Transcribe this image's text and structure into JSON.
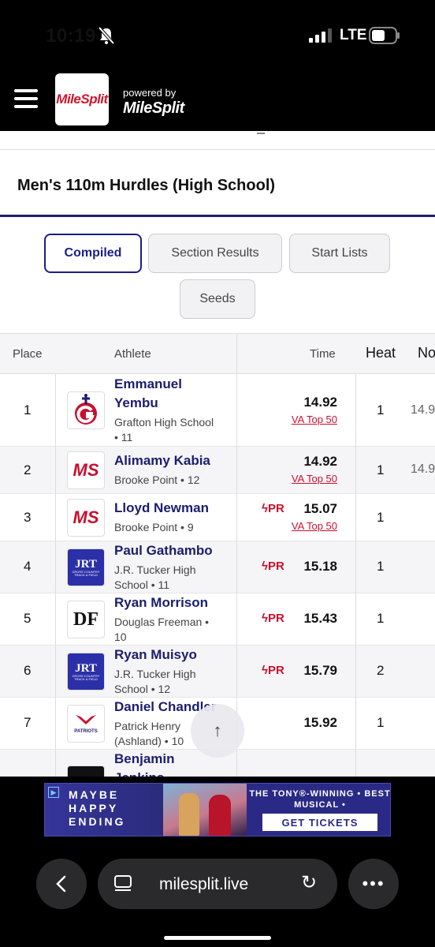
{
  "status_bar": {
    "time": "10:19",
    "network": "LTE"
  },
  "header": {
    "logo_text": "MileSplit",
    "powered_by": "powered by",
    "brand": "MileSplit"
  },
  "event": {
    "title": "Men's 110m Hurdles (High School)"
  },
  "tabs": [
    {
      "label": "Compiled",
      "active": true
    },
    {
      "label": "Section Results",
      "active": false
    },
    {
      "label": "Start Lists",
      "active": false
    },
    {
      "label": "Seeds",
      "active": false
    }
  ],
  "table": {
    "columns": {
      "place": "Place",
      "athlete": "Athlete",
      "time": "Time",
      "heat": "Heat",
      "note": "No"
    },
    "rows": [
      {
        "place": "1",
        "name_line1": "Emmanuel",
        "name_line2": "Yembu",
        "school_line1": "Grafton High School",
        "school_line2": "• 11",
        "time": "14.92",
        "badge": "VA Top 50",
        "pr": "",
        "heat": "1",
        "note": "14.9",
        "logo": "grafton-logo"
      },
      {
        "place": "2",
        "name_line1": "Alimamy Kabia",
        "name_line2": "",
        "school_line1": "Brooke Point • 12",
        "school_line2": "",
        "time": "14.92",
        "badge": "VA Top 50",
        "pr": "",
        "heat": "1",
        "note": "14.9",
        "logo": "ms-logo"
      },
      {
        "place": "3",
        "name_line1": "Lloyd Newman",
        "name_line2": "",
        "school_line1": "Brooke Point • 9",
        "school_line2": "",
        "time": "15.07",
        "badge": "VA Top 50",
        "pr": "PR",
        "heat": "1",
        "note": "",
        "logo": "ms-logo"
      },
      {
        "place": "4",
        "name_line1": "Paul Gathambo",
        "name_line2": "",
        "school_line1": "J.R. Tucker High",
        "school_line2": "School • 11",
        "time": "15.18",
        "badge": "",
        "pr": "PR",
        "heat": "1",
        "note": "",
        "logo": "jrt-logo"
      },
      {
        "place": "5",
        "name_line1": "Ryan Morrison",
        "name_line2": "",
        "school_line1": "Douglas Freeman •",
        "school_line2": "10",
        "time": "15.43",
        "badge": "",
        "pr": "PR",
        "heat": "1",
        "note": "",
        "logo": "df-logo"
      },
      {
        "place": "6",
        "name_line1": "Ryan Muisyo",
        "name_line2": "",
        "school_line1": "J.R. Tucker High",
        "school_line2": "School • 12",
        "time": "15.79",
        "badge": "",
        "pr": "PR",
        "heat": "2",
        "note": "",
        "logo": "jrt-logo"
      },
      {
        "place": "7",
        "name_line1": "Daniel Chandler",
        "name_line2": "",
        "school_line1": "Patrick Henry",
        "school_line2": "(Ashland) • 10",
        "time": "15.92",
        "badge": "",
        "pr": "",
        "heat": "1",
        "note": "",
        "logo": "patriots-logo"
      },
      {
        "place": "",
        "name_line1": "Benjamin",
        "name_line2": "Jenkins",
        "school_line1": "",
        "school_line2": "",
        "time": "",
        "badge": "",
        "pr": "",
        "heat": "",
        "note": "",
        "logo": "generic-logo"
      }
    ]
  },
  "logos": {
    "jrt_main": "JRT",
    "jrt_sub": "CROSS COUNTRY\nTRACK & FIELD",
    "ms": "MS",
    "df": "DF",
    "patriots": "PATRIOTS"
  },
  "ad": {
    "title": "MAYBE HAPPY ENDING",
    "tagline": "THE TONY®-WINNING • BEST MUSICAL •",
    "cta": "GET TICKETS"
  },
  "browser": {
    "url": "milesplit.live"
  },
  "colors": {
    "navy": "#1b1d6e",
    "red": "#c8102e",
    "ad_bg": "#2a2a86"
  }
}
